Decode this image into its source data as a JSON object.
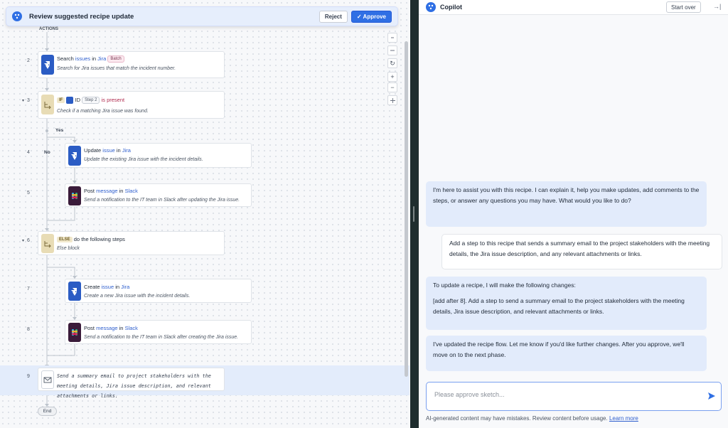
{
  "review_bar": {
    "title": "Review suggested recipe update",
    "reject_label": "Reject",
    "approve_label": "✓ Approve"
  },
  "canvas": {
    "actions_label": "ACTIONS",
    "steps": [
      {
        "num": "2",
        "verb": "Search",
        "obj": "issues",
        "in": "in",
        "app": "Jira",
        "badge": "Batch",
        "desc": "Search for Jira issues that match the incident number."
      },
      {
        "num": "3",
        "kw": "IF",
        "field": "ID",
        "step_ref": "Step 2",
        "cond": "is present",
        "desc": "Check if a matching Jira issue was found."
      },
      {
        "num": "4",
        "verb": "Update",
        "obj": "issue",
        "in": "in",
        "app": "Jira",
        "desc": "Update the existing Jira issue with the incident details."
      },
      {
        "num": "5",
        "verb": "Post",
        "obj": "message",
        "in": "in",
        "app": "Slack",
        "desc": "Send a notification to the IT team in Slack after updating the Jira issue."
      },
      {
        "num": "6",
        "kw": "ELSE",
        "title": "do the following steps",
        "desc": "Else block"
      },
      {
        "num": "7",
        "verb": "Create",
        "obj": "issue",
        "in": "in",
        "app": "Jira",
        "desc": "Create a new Jira issue with the incident details."
      },
      {
        "num": "8",
        "verb": "Post",
        "obj": "message",
        "in": "in",
        "app": "Slack",
        "desc": "Send a notification to the IT team in Slack after creating the Jira issue."
      },
      {
        "num": "9",
        "desc": "Send a summary email to project stakeholders with the meeting details, Jira issue description, and relevant attachments or links."
      }
    ],
    "yes_label": "Yes",
    "no_label": "No",
    "end_label": "End"
  },
  "copilot": {
    "title": "Copilot",
    "start_over": "Start over",
    "messages": [
      {
        "role": "bot",
        "paragraphs": [
          "I'm here to assist you with this recipe. I can explain it, help you make updates, add comments to the steps, or answer any questions you may have. What would you like to do?"
        ]
      },
      {
        "role": "user",
        "paragraphs": [
          "Add a step to this recipe that sends a summary email to the project stakeholders with the meeting details, the Jira issue description, and any relevant attachments or links."
        ]
      },
      {
        "role": "bot",
        "paragraphs": [
          "To update a recipe, I will make the following changes:",
          "[add after 8]. Add a step to send a summary email to the project stakeholders with the meeting details, Jira issue description, and relevant attachments or links."
        ]
      },
      {
        "role": "bot",
        "paragraphs": [
          "I've updated the recipe flow. Let me know if you'd like further changes. After you approve, we'll move on to the next phase."
        ]
      }
    ],
    "input_placeholder": "Please approve sketch...",
    "disclaimer": "AI-generated content may have mistakes. Review content before usage.",
    "learn_more": "Learn more"
  },
  "colors": {
    "accent": "#2f6fe4",
    "jira": "#2b5cc4",
    "slack": "#3a1b3a",
    "bot_bubble": "#e2ebfb",
    "highlight": "#e3ecfb"
  }
}
